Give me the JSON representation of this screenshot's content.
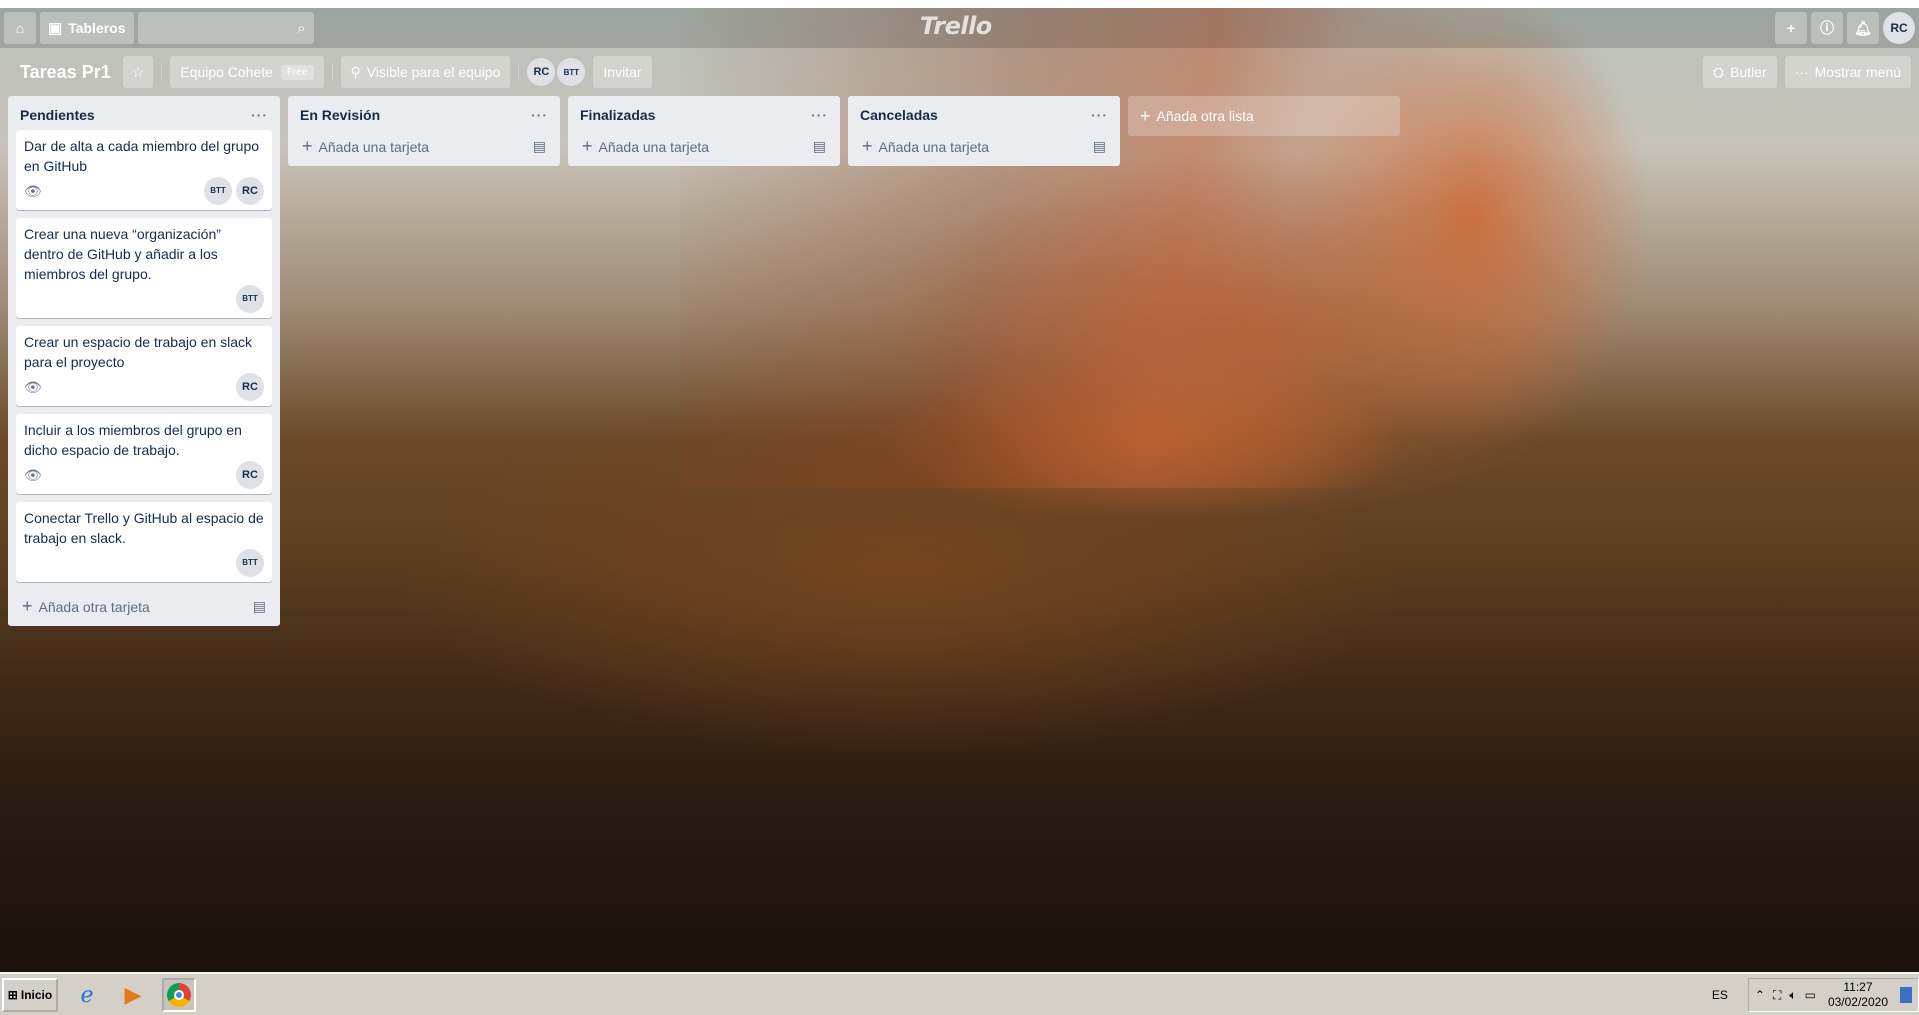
{
  "header": {
    "home_icon": "home-icon",
    "boards_label": "Tableros",
    "search_placeholder": "",
    "logo": "Trello",
    "user_initials": "RC"
  },
  "board": {
    "title": "Tareas Pr1",
    "team": "Equipo Cohete",
    "team_badge": "Free",
    "visibility": "Visible para el equipo",
    "members": [
      "RC",
      "BTT"
    ],
    "invite": "Invitar",
    "butler": "Butler",
    "show_menu": "Mostrar menú"
  },
  "lists": [
    {
      "title": "Pendientes",
      "cards": [
        {
          "text": "Dar de alta a cada miembro del grupo en GitHub",
          "watch": true,
          "members": [
            "BTT",
            "RC"
          ]
        },
        {
          "text": "Crear una nueva “organización” dentro de GitHub y añadir a los miembros del grupo.",
          "watch": false,
          "members": [
            "BTT"
          ]
        },
        {
          "text": "Crear un espacio de trabajo en slack para el proyecto",
          "watch": true,
          "members": [
            "RC"
          ]
        },
        {
          "text": "Incluir a los miembros del grupo en dicho espacio de trabajo.",
          "watch": true,
          "members": [
            "RC"
          ]
        },
        {
          "text": "Conectar Trello y GitHub al espacio de trabajo en slack.",
          "watch": false,
          "members": [
            "BTT"
          ]
        }
      ],
      "add_label": "Añada otra tarjeta"
    },
    {
      "title": "En Revisión",
      "cards": [],
      "add_label": "Añada una tarjeta"
    },
    {
      "title": "Finalizadas",
      "cards": [],
      "add_label": "Añada una tarjeta"
    },
    {
      "title": "Canceladas",
      "cards": [],
      "add_label": "Añada una tarjeta"
    }
  ],
  "add_list_label": "Añada otra lista",
  "taskbar": {
    "start_label": "Inicio",
    "language": "ES",
    "time": "11:27",
    "date": "03/02/2020"
  }
}
